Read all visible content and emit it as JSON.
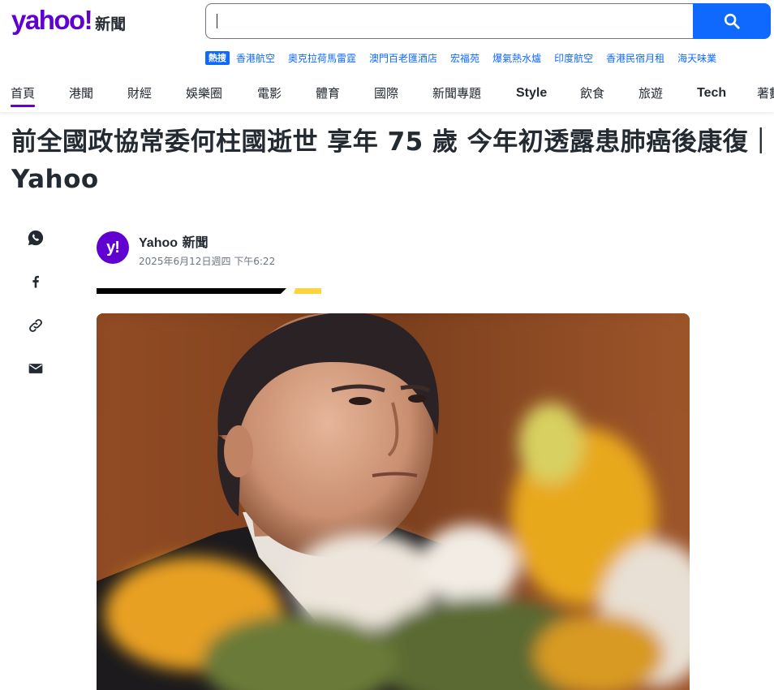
{
  "header": {
    "logo_text": "yahoo!",
    "logo_sub": "新聞",
    "search": {
      "value": "",
      "placeholder": ""
    },
    "trending": {
      "badge": "熱搜",
      "items": [
        "香港航空",
        "奧克拉荷馬雷霆",
        "澳門百老匯酒店",
        "宏福苑",
        "爆氣熱水爐",
        "印度航空",
        "香港民宿月租",
        "海天味業"
      ]
    },
    "nav": [
      "首頁",
      "港聞",
      "財經",
      "娛樂圈",
      "電影",
      "體育",
      "國際",
      "新聞專題",
      "Style",
      "飲食",
      "旅遊",
      "Tech",
      "著數"
    ]
  },
  "article": {
    "headline": "前全國政協常委何柱國逝世 享年 75 歲 今年初透露患肺癌後康復｜Yahoo",
    "author_en": "Yahoo",
    "author_zh": "新聞",
    "avatar_text": "y!",
    "date": "2025年6月12日週四 下午6:22"
  },
  "share_icons": [
    "whatsapp-icon",
    "facebook-icon",
    "link-icon",
    "mail-icon"
  ],
  "colors": {
    "brand": "#6001d2",
    "search_button": "#0f69ff",
    "accent_yellow": "#ffd33d"
  }
}
